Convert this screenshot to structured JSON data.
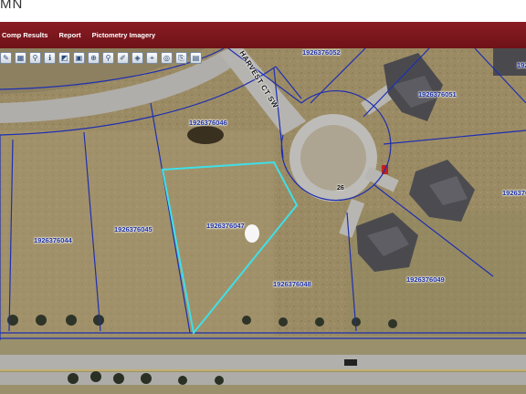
{
  "header": {
    "title_fragment": "MN"
  },
  "nav": {
    "items": [
      {
        "label": "Comp Results"
      },
      {
        "label": "Report"
      },
      {
        "label": "Pictometry Imagery"
      }
    ]
  },
  "toolbar": {
    "tools": [
      {
        "icon": "pan-tool-icon",
        "glyph": "✎"
      },
      {
        "icon": "map-layers-icon",
        "glyph": "▦"
      },
      {
        "icon": "pin-tool-icon",
        "glyph": "⚲"
      },
      {
        "icon": "info-tool-icon",
        "glyph": "ℹ"
      },
      {
        "icon": "measure-tool-icon",
        "glyph": "◩"
      },
      {
        "icon": "print-tool-icon",
        "glyph": "▣"
      },
      {
        "icon": "identify-tool-icon",
        "glyph": "⊕"
      },
      {
        "icon": "search-tool-icon",
        "glyph": "⚲"
      },
      {
        "icon": "draw-tool-icon",
        "glyph": "✐"
      },
      {
        "icon": "select-tool-icon",
        "glyph": "◈"
      },
      {
        "icon": "zoom-extent-icon",
        "glyph": "⌖"
      },
      {
        "icon": "buffer-tool-icon",
        "glyph": "◎"
      },
      {
        "icon": "export-tool-icon",
        "glyph": "⎘"
      },
      {
        "icon": "save-tool-icon",
        "glyph": "▤"
      }
    ]
  },
  "map": {
    "street_name": "HARVEST CT SW",
    "address_number": "26",
    "parcel_ids": {
      "p052": "1926376052",
      "p051": "1926376051",
      "p050": "192637605",
      "p046": "1926376046",
      "p045": "1926376045",
      "p044": "1926376044",
      "p047": "1926376047",
      "p048": "1926376048",
      "p049": "1926376049",
      "p5edge": "1926376"
    },
    "colors": {
      "parcel_line": "#1e2fb0",
      "selected_outline": "#3ee0e8",
      "nav_bar": "#7a161d",
      "grass": "#9a8a63"
    }
  }
}
